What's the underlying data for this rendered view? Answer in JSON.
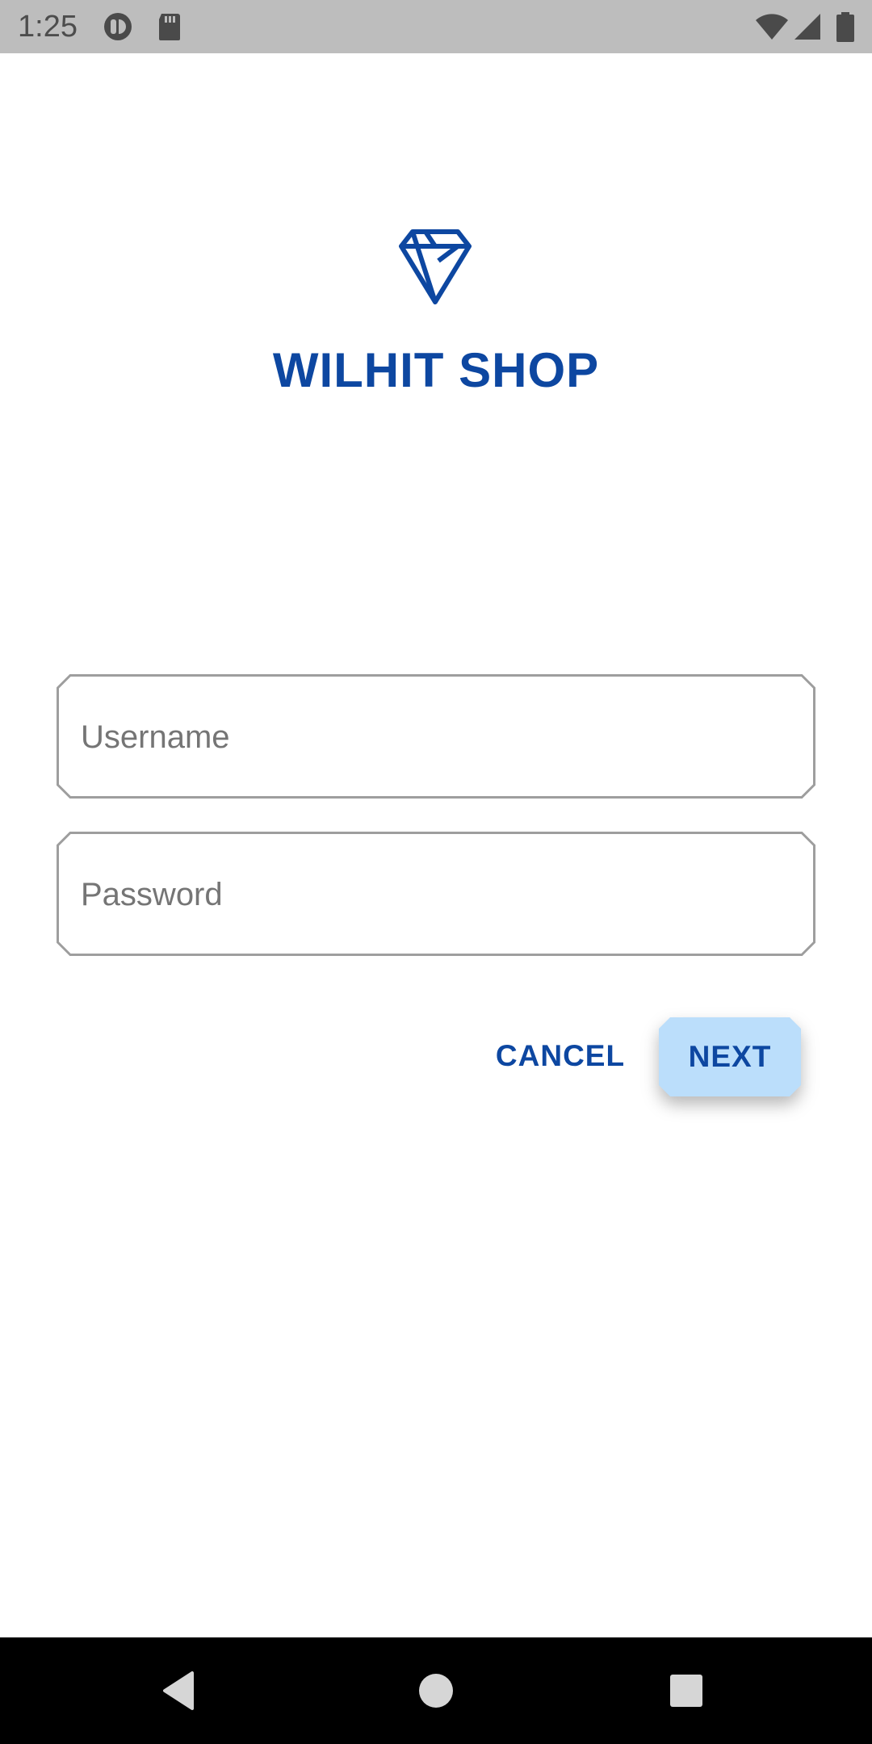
{
  "status_bar": {
    "time": "1:25",
    "left_icons": [
      "app-notification-icon",
      "sd-card-icon"
    ],
    "right_icons": [
      "wifi-icon",
      "cellular-signal-icon",
      "battery-icon"
    ]
  },
  "brand": {
    "logo_icon": "diamond-icon",
    "title": "WILHIT SHOP",
    "color": "#0d47a1"
  },
  "form": {
    "username_placeholder": "Username",
    "username_value": "",
    "password_placeholder": "Password",
    "password_value": ""
  },
  "actions": {
    "cancel_label": "CANCEL",
    "next_label": "NEXT",
    "next_background": "#bbdefb"
  },
  "navigation": {
    "buttons": [
      "back-icon",
      "home-icon",
      "recents-icon"
    ]
  }
}
